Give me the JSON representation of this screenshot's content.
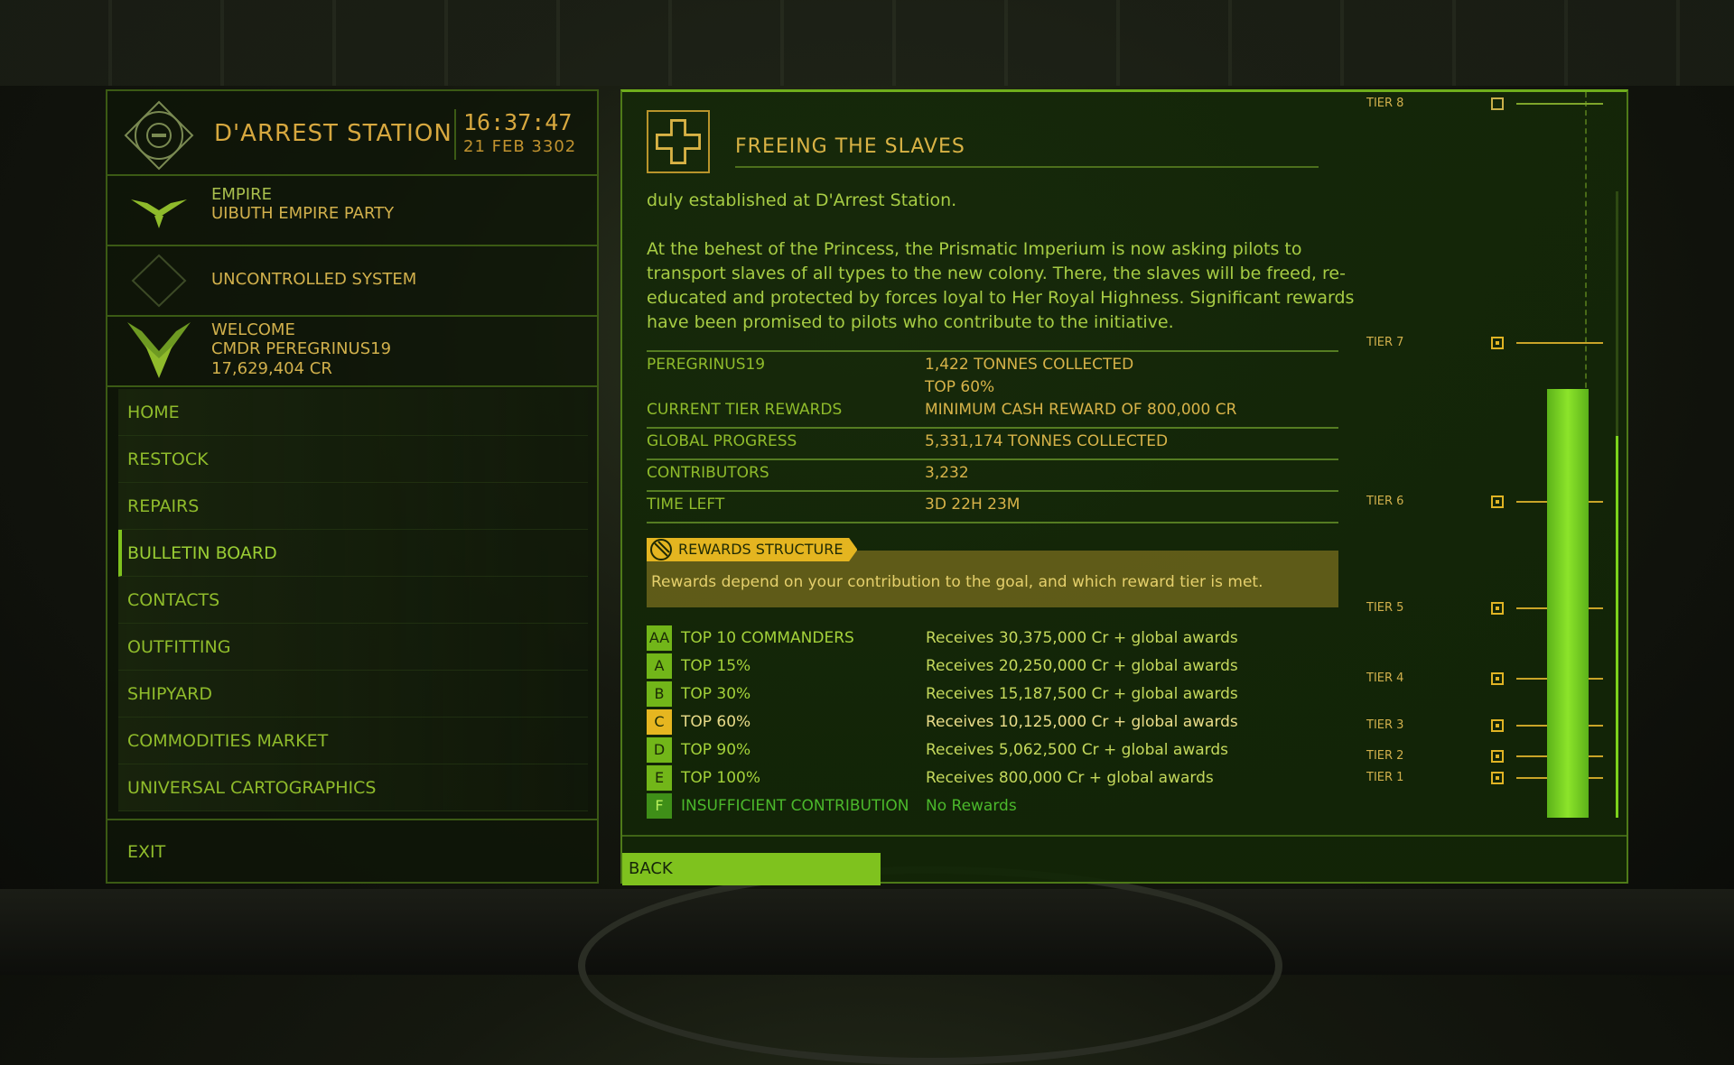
{
  "station": {
    "name": "D'ARREST STATION",
    "time": "16:37:47",
    "date": "21 FEB 3302",
    "allegiance": "EMPIRE",
    "faction": "UIBUTH EMPIRE PARTY",
    "system_status": "UNCONTROLLED SYSTEM",
    "welcome": "WELCOME",
    "commander": "CMDR PEREGRINUS19",
    "credits": "17,629,404 CR"
  },
  "menu": {
    "items": [
      {
        "label": "HOME"
      },
      {
        "label": "RESTOCK"
      },
      {
        "label": "REPAIRS"
      },
      {
        "label": "BULLETIN BOARD",
        "active": true
      },
      {
        "label": "CONTACTS"
      },
      {
        "label": "OUTFITTING"
      },
      {
        "label": "SHIPYARD"
      },
      {
        "label": "COMMODITIES MARKET"
      },
      {
        "label": "UNIVERSAL CARTOGRAPHICS"
      }
    ],
    "exit": "EXIT"
  },
  "mission": {
    "title": "FREEING THE SLAVES",
    "intro": "duly established at D'Arrest Station.",
    "description": "At the behest of the Princess, the Prismatic Imperium is now asking pilots to transport slaves of all types to the new colony. There, the slaves will be freed, re-educated and protected by forces loyal to Her Royal Highness. Significant rewards have been promised to pilots who contribute to the initiative.",
    "stats": {
      "player_label": "PEREGRINUS19",
      "player_value": "1,422 TONNES COLLECTED",
      "player_rank": "TOP 60%",
      "tier_rewards_label": "CURRENT TIER REWARDS",
      "tier_rewards_value": "MINIMUM CASH REWARD OF 800,000 CR",
      "global_label": "GLOBAL PROGRESS",
      "global_value": "5,331,174 TONNES COLLECTED",
      "contributors_label": "CONTRIBUTORS",
      "contributors_value": "3,232",
      "time_label": "TIME LEFT",
      "time_value": "3D 22H 23M"
    },
    "rewards_title": "REWARDS STRUCTURE",
    "rewards_desc": "Rewards depend on your contribution to the goal, and which reward tier is met.",
    "tiers": [
      {
        "grade": "AA",
        "name": "TOP 10 COMMANDERS",
        "reward": "Receives 30,375,000 Cr + global awards"
      },
      {
        "grade": "A",
        "name": "TOP 15%",
        "reward": "Receives 20,250,000 Cr + global awards"
      },
      {
        "grade": "B",
        "name": "TOP 30%",
        "reward": "Receives 15,187,500 Cr + global awards"
      },
      {
        "grade": "C",
        "name": "TOP 60%",
        "reward": "Receives 10,125,000 Cr + global awards",
        "current": true
      },
      {
        "grade": "D",
        "name": "TOP 90%",
        "reward": "Receives 5,062,500 Cr + global awards"
      },
      {
        "grade": "E",
        "name": "TOP 100%",
        "reward": "Receives 800,000 Cr + global awards"
      },
      {
        "grade": "F",
        "name": "INSUFFICIENT CONTRIBUTION",
        "reward": "No Rewards",
        "insufficient": true
      }
    ],
    "back_label": "BACK"
  },
  "progress": {
    "tier_labels": [
      "TIER 8",
      "TIER 7",
      "TIER 6",
      "TIER 5",
      "TIER 4",
      "TIER 3",
      "TIER 2",
      "TIER 1"
    ],
    "tier_reached_fraction": 0.82,
    "rail_fill_fraction": 0.61
  },
  "colors": {
    "accent": "#7fc21e",
    "gold": "#d7a83f",
    "panel_border": "#3b5a14"
  }
}
